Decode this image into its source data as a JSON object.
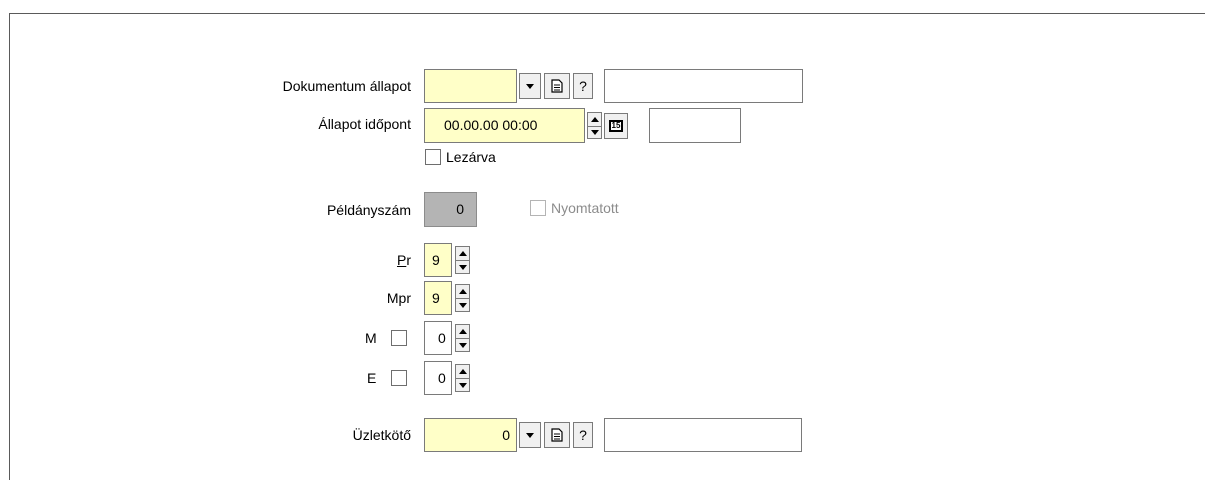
{
  "form": {
    "dokumentum_allapot": {
      "label": "Dokumentum állapot",
      "value": "",
      "description": "",
      "help": "?"
    },
    "allapot_idopont": {
      "label": "Állapot időpont",
      "value": "00.00.00 00:00",
      "extra": "",
      "calendar_icon_text": "15"
    },
    "lezarva": {
      "label": "Lezárva",
      "checked": false
    },
    "peldanyszam": {
      "label": "Példányszám",
      "value": "0"
    },
    "nyomtatott": {
      "label": "Nyomtatott",
      "checked": false,
      "disabled": true
    },
    "pr": {
      "label_underlined": "P",
      "label_rest": "r",
      "value": "9"
    },
    "mpr": {
      "label": "Mpr",
      "value": "9"
    },
    "m": {
      "label": "M",
      "checked": false,
      "value": "0"
    },
    "e": {
      "label": "E",
      "checked": false,
      "value": "0"
    },
    "uzletkoto": {
      "label": "Üzletkötő",
      "value": "0",
      "description": "",
      "help": "?"
    }
  },
  "colors": {
    "required_bg": "#ffffc8",
    "readonly_bg": "#b4b4b4",
    "disabled_text": "#8c8c8c"
  },
  "icons": {
    "dropdown": "chevron-down-icon",
    "details": "document-icon",
    "calendar": "calendar-icon",
    "spinner": "spinner-arrows-icon"
  }
}
